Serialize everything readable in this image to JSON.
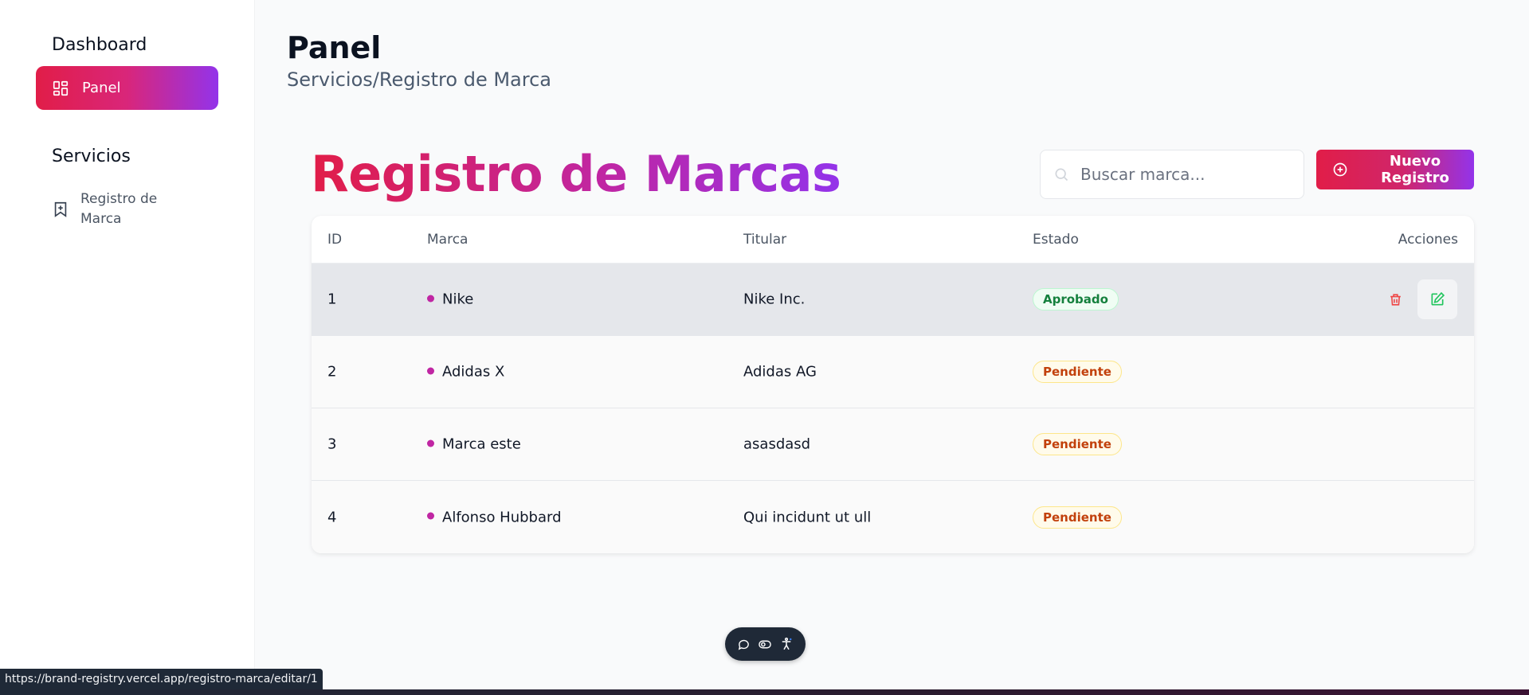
{
  "sidebar": {
    "dashboard_title": "Dashboard",
    "panel_label": "Panel",
    "servicios_title": "Servicios",
    "registro_label": "Registro de Marca"
  },
  "header": {
    "title": "Panel",
    "breadcrumb": "Servicios/Registro de Marca"
  },
  "main": {
    "heading": "Registro de Marcas",
    "search_placeholder": "Buscar marca...",
    "new_button": "Nuevo Registro"
  },
  "table": {
    "columns": [
      "ID",
      "Marca",
      "Titular",
      "Estado",
      "Acciones"
    ],
    "rows": [
      {
        "id": "1",
        "marca": "Nike",
        "titular": "Nike Inc.",
        "estado": "Aprobado"
      },
      {
        "id": "2",
        "marca": "Adidas X",
        "titular": "Adidas AG",
        "estado": "Pendiente"
      },
      {
        "id": "3",
        "marca": "Marca este",
        "titular": "asasdasd",
        "estado": "Pendiente"
      },
      {
        "id": "4",
        "marca": "Alfonso Hubbard",
        "titular": "Qui incidunt ut ull",
        "estado": "Pendiente"
      }
    ]
  },
  "status_url": "https://brand-registry.vercel.app/registro-marca/editar/1",
  "colors": {
    "accent_start": "#e11d48",
    "accent_end": "#9333ea",
    "approved": "#15803d",
    "pending": "#c2410c",
    "delete": "#ef4444",
    "edit": "#22c55e"
  },
  "icons": {
    "panel": "grid-icon",
    "registro": "bookmark-plus-icon",
    "search": "search-icon",
    "new": "plus-circle-icon",
    "delete": "trash-icon",
    "edit": "edit-icon",
    "fab": [
      "chat-icon",
      "toggle-icon",
      "accessibility-icon"
    ]
  }
}
